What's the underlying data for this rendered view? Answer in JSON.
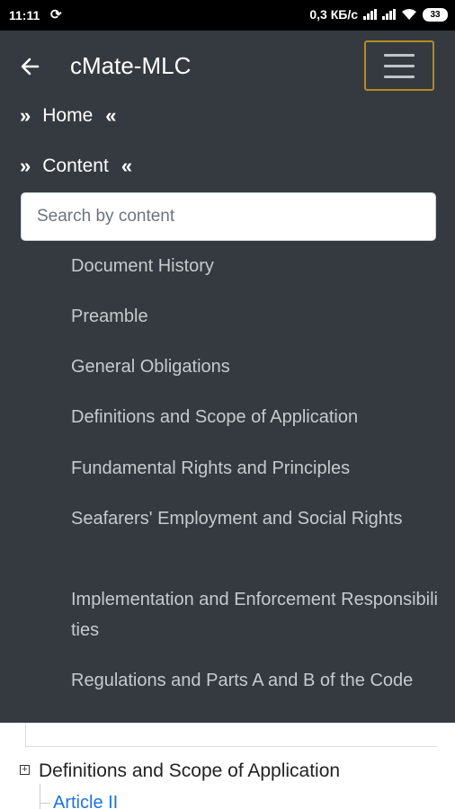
{
  "status_bar": {
    "time": "11:11",
    "speed": "0,3 КБ/с",
    "battery": "33"
  },
  "header": {
    "title": "cMate-MLC"
  },
  "nav": {
    "home_label": "Home",
    "content_label": "Content"
  },
  "search": {
    "placeholder": "Search by content",
    "value": ""
  },
  "toc": {
    "items": [
      "Document History",
      "Preamble",
      "General Obligations",
      "Definitions and Scope of Application",
      "Fundamental Rights and Principles",
      "Seafarers' Employment and Social Rights",
      "Implementation and Enforcement Responsibilities",
      "Regulations and Parts A and B of the Code"
    ]
  },
  "page": {
    "section_title": "Definitions and Scope of Application",
    "article_link": "Article II"
  },
  "colors": {
    "drawer_bg": "#343a40",
    "menu_border": "#b58a1f",
    "link": "#1a73e8"
  }
}
